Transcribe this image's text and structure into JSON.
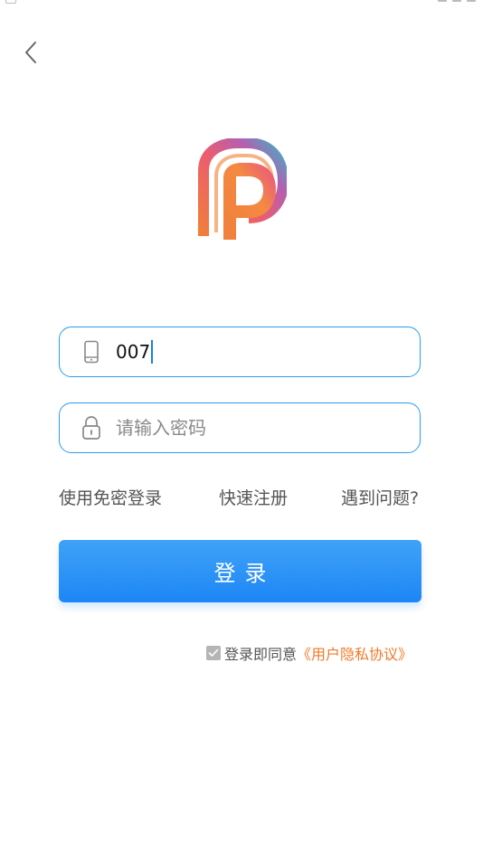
{
  "login": {
    "phone_value": "007",
    "password_placeholder": "请输入密码"
  },
  "links": {
    "sms_login": "使用免密登录",
    "register": "快速注册",
    "help": "遇到问题?"
  },
  "login_button_label": "登录",
  "agreement": {
    "checked": true,
    "text": "登录即同意",
    "link": "《用户隐私协议》"
  },
  "icons": {
    "back": "chevron-left-icon",
    "phone": "phone-icon",
    "lock": "lock-icon",
    "check": "check-icon",
    "logo": "app-logo"
  },
  "colors": {
    "accent": "#1d86f5",
    "field_border": "#2a9bf0",
    "agreement_link": "#f07a2a",
    "logo_orange": "#f07f3a",
    "logo_pink": "#e8508a",
    "logo_teal": "#37b6c8"
  }
}
